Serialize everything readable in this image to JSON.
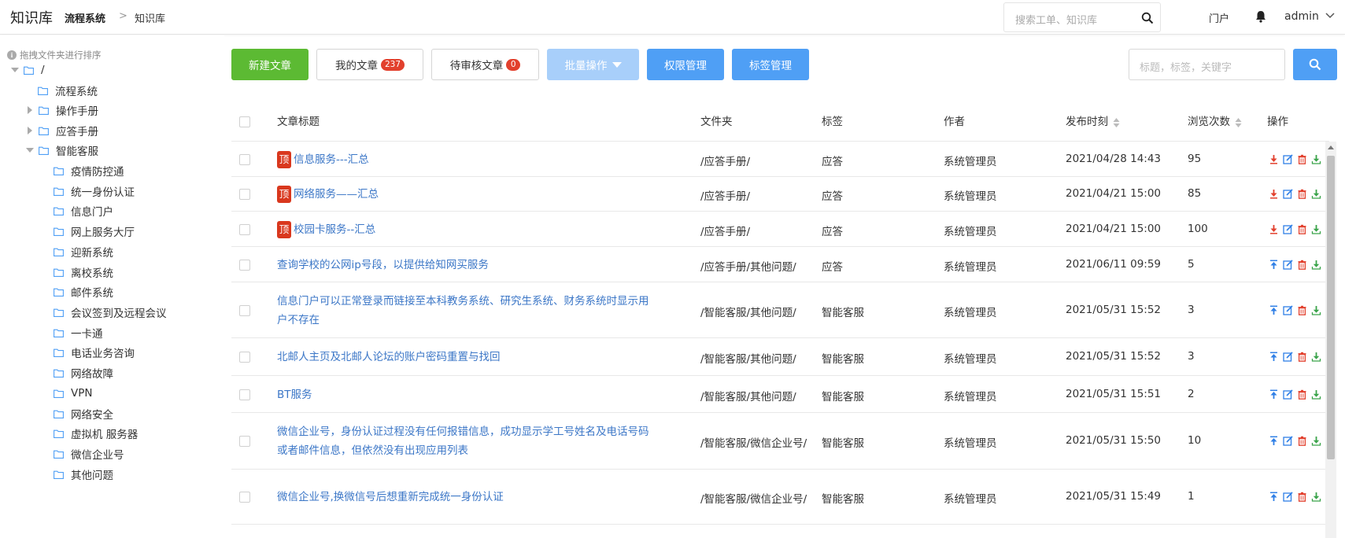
{
  "header": {
    "app_title": "知识库",
    "breadcrumb": [
      "流程系统",
      "知识库"
    ],
    "breadcrumb_sep": ">",
    "search_placeholder": "搜索工单、知识库",
    "portal_label": "门户",
    "user_name": "admin"
  },
  "sidebar": {
    "hint": "拖拽文件夹进行排序",
    "tree": [
      {
        "label": "/",
        "expanded": true
      },
      {
        "label": "流程系统"
      },
      {
        "label": "操作手册",
        "expanded": false
      },
      {
        "label": "应答手册",
        "expanded": false
      },
      {
        "label": "智能客服",
        "expanded": true
      },
      {
        "label": "疫情防控通"
      },
      {
        "label": "统一身份认证"
      },
      {
        "label": "信息门户"
      },
      {
        "label": "网上服务大厅"
      },
      {
        "label": "迎新系统"
      },
      {
        "label": "离校系统"
      },
      {
        "label": "邮件系统"
      },
      {
        "label": "会议签到及远程会议"
      },
      {
        "label": "一卡通"
      },
      {
        "label": "电话业务咨询"
      },
      {
        "label": "网络故障"
      },
      {
        "label": "VPN"
      },
      {
        "label": "网络安全"
      },
      {
        "label": "虚拟机 服务器"
      },
      {
        "label": "微信企业号"
      },
      {
        "label": "其他问题"
      }
    ]
  },
  "toolbar": {
    "new_article": "新建文章",
    "my_articles": "我的文章",
    "my_articles_count": "237",
    "pending_review": "待审核文章",
    "pending_count": "0",
    "batch_ops": "批量操作",
    "permissions": "权限管理",
    "tag_manage": "标签管理",
    "filter_placeholder": "标题，标签，关键字"
  },
  "table": {
    "columns": {
      "title": "文章标题",
      "folder": "文件夹",
      "tag": "标签",
      "author": "作者",
      "published": "发布时刻",
      "views": "浏览次数",
      "actions": "操作"
    },
    "top_label": "顶",
    "rows": [
      {
        "title": "信息服务---汇总",
        "pinned": true,
        "folder": "/应答手册/",
        "tag": "应答",
        "author": "系统管理员",
        "published": "2021/04/28 14:43",
        "views": "95"
      },
      {
        "title": "网络服务——汇总",
        "pinned": true,
        "folder": "/应答手册/",
        "tag": "应答",
        "author": "系统管理员",
        "published": "2021/04/21 15:00",
        "views": "85"
      },
      {
        "title": "校园卡服务--汇总",
        "pinned": true,
        "folder": "/应答手册/",
        "tag": "应答",
        "author": "系统管理员",
        "published": "2021/04/21 15:00",
        "views": "100"
      },
      {
        "title": "查询学校的公网ip号段，以提供给知网买服务",
        "pinned": false,
        "folder": "/应答手册/其他问题/",
        "tag": "应答",
        "author": "系统管理员",
        "published": "2021/06/11 09:59",
        "views": "5"
      },
      {
        "title": "信息门户可以正常登录而链接至本科教务系统、研究生系统、财务系统时显示用户不存在",
        "pinned": false,
        "folder": "/智能客服/其他问题/",
        "tag": "智能客服",
        "author": "系统管理员",
        "published": "2021/05/31 15:52",
        "views": "3"
      },
      {
        "title": "北邮人主页及北邮人论坛的账户密码重置与找回",
        "pinned": false,
        "folder": "/智能客服/其他问题/",
        "tag": "智能客服",
        "author": "系统管理员",
        "published": "2021/05/31 15:52",
        "views": "3"
      },
      {
        "title": "BT服务",
        "pinned": false,
        "folder": "/智能客服/其他问题/",
        "tag": "智能客服",
        "author": "系统管理员",
        "published": "2021/05/31 15:51",
        "views": "2"
      },
      {
        "title": "微信企业号，身份认证过程没有任何报错信息，成功显示学工号姓名及电话号码或者邮件信息，但依然没有出现应用列表",
        "pinned": false,
        "folder": "/智能客服/微信企业号/",
        "tag": "智能客服",
        "author": "系统管理员",
        "published": "2021/05/31 15:50",
        "views": "10"
      },
      {
        "title": "微信企业号,换微信号后想重新完成统一身份认证",
        "pinned": false,
        "folder": "/智能客服/微信企业号/",
        "tag": "智能客服",
        "author": "系统管理员",
        "published": "2021/05/31 15:49",
        "views": "1"
      }
    ]
  },
  "colors": {
    "primary": "#4f9ff5",
    "success": "#5cba33",
    "danger": "#e2402d",
    "link": "#3c77c7"
  },
  "icons": {
    "search": "search-icon",
    "bell": "bell-icon",
    "folder": "folder-icon",
    "pin_down": "download-pin-icon",
    "pin_up": "pin-to-top-icon",
    "edit": "edit-icon",
    "delete": "trash-icon",
    "download": "download-icon"
  }
}
